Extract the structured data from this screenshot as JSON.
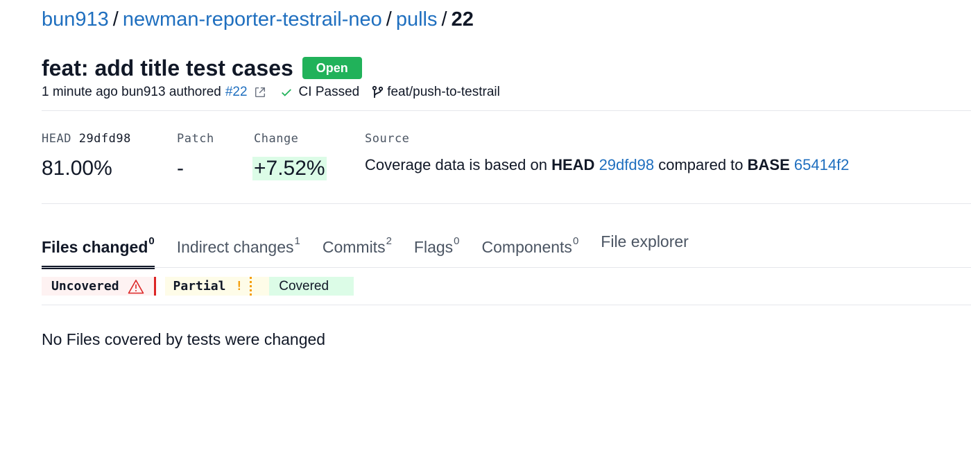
{
  "breadcrumb": {
    "owner": "bun913",
    "repo": "newman-reporter-testrail-neo",
    "section": "pulls",
    "current": "22",
    "separator": "/"
  },
  "pull": {
    "title": "feat: add title test cases",
    "status": "Open",
    "time": "1 minute ago",
    "author": "bun913",
    "authored_label": "authored",
    "number_link": "#22",
    "ci_status": "CI Passed",
    "branch": "feat/push-to-testrail"
  },
  "stats": {
    "head": {
      "label": "HEAD",
      "sha": "29dfd98",
      "value": "81.00%"
    },
    "patch": {
      "label": "Patch",
      "value": "-"
    },
    "change": {
      "label": "Change",
      "value": "+7.52%"
    },
    "source": {
      "label": "Source",
      "prefix": "Coverage data is based on",
      "head_word": "HEAD",
      "head_sha": "29dfd98",
      "middle": "compared to",
      "base_word": "BASE",
      "base_sha": "65414f2"
    }
  },
  "tabs": [
    {
      "label": "Files changed",
      "count": "0"
    },
    {
      "label": "Indirect changes",
      "count": "1"
    },
    {
      "label": "Commits",
      "count": "2"
    },
    {
      "label": "Flags",
      "count": "0"
    },
    {
      "label": "Components",
      "count": "0"
    },
    {
      "label": "File explorer",
      "count": ""
    }
  ],
  "legend": {
    "uncovered": "Uncovered",
    "partial": "Partial",
    "partial_mark": "!",
    "covered": "Covered"
  },
  "empty_message": "No Files covered by tests were changed",
  "colors": {
    "link": "#1f6fbf",
    "open_badge": "#21b25a",
    "uncovered": "#dc2626",
    "partial": "#f59e0b",
    "covered_bg": "#dcfce7"
  }
}
